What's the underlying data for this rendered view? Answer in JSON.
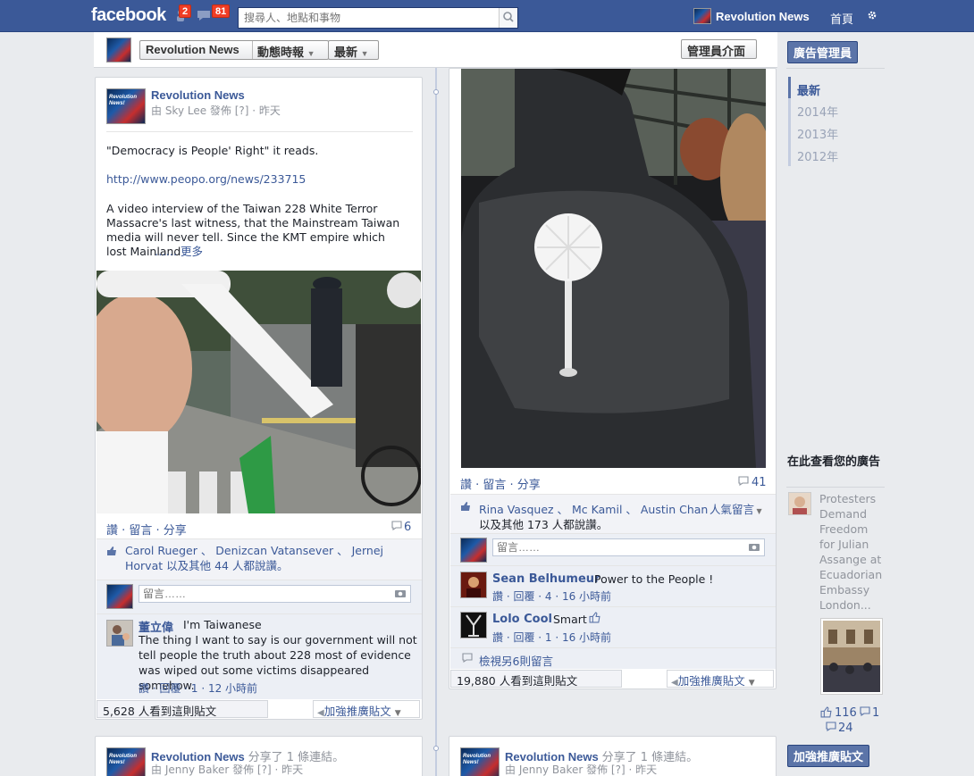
{
  "topbar": {
    "logo": "facebook",
    "friend_badge": "2",
    "notif_badge": "81",
    "search_placeholder": "搜尋人、地點和事物",
    "page_name": "Revolution News",
    "home": "首頁"
  },
  "header": {
    "page_name": "Revolution News",
    "timeline": "動態時報",
    "recent": "最新",
    "admin_panel": "管理員介面"
  },
  "sidebar": {
    "ad_manager": "廣告管理員",
    "years": [
      "最新",
      "2014年",
      "2013年",
      "2012年"
    ],
    "ads_title": "在此查看您的廣告",
    "ad_text": "Protesters Demand Freedom for Julian Assange at Ecuadorian Embassy London...",
    "likes": "116",
    "comments": "1",
    "shares": "24",
    "promote": "加強推廣貼文"
  },
  "post1": {
    "page_name": "Revolution News",
    "byline": "由 Sky Lee 發佈 [?] · 昨天",
    "quote": "\"Democracy is People' Right\" it reads.",
    "link": "http://www.peopo.org/news/233715",
    "text": "A video interview of the Taiwan 228 White Terror Massacre's last witness, that the Mainstream Taiwan media will never tell. Since the KMT empire which lost Mainland",
    "more": "…… 更多",
    "actions": "讚 · 留言 · 分享",
    "comment_count": "6",
    "likers": "Carol Rueger 、 Denizcan Vatansever 、 Jernej Horvat 以及其他 44 人都說讚。",
    "comment_placeholder": "留言……",
    "comment_author": "董立偉",
    "comment_lead": "I'm Taiwanese",
    "comment_body": "The thing I want to say is our government will not tell people the truth about 228 most of evidence was wiped out some victims disappeared somehow.",
    "comment_meta": "讚 · 回覆 · 1 · 12 小時前",
    "seen": "5,628 人看到這則貼文",
    "promote": "加強推廣貼文"
  },
  "post2": {
    "actions": "讚 · 留言 · 分享",
    "comment_count": "41",
    "likers_names": "Rina Vasquez 、 Mc Kamil 、 Austin Chan",
    "likers_rest": "以及其他 173 人都說讚。",
    "popular": "人氣留言",
    "comment_placeholder": "留言……",
    "c1_author": "Sean Belhumeur",
    "c1_text": "Power to the People !",
    "c1_meta": "讚 · 回覆 · 4 · 16 小時前",
    "c2_author": "Lolo Cool",
    "c2_text": "Smart",
    "c2_meta": "讚 · 回覆 · 1 · 16 小時前",
    "view_more": "檢視另6則留言",
    "seen": "19,880 人看到這則貼文",
    "promote": "加強推廣貼文"
  },
  "post3": {
    "page_name": "Revolution News",
    "shared": "分享了 1 條連結。",
    "byline": "由 Jenny Baker 發佈 [?] · 昨天"
  },
  "post4": {
    "page_name": "Revolution News",
    "shared": "分享了 1 條連結。",
    "byline": "由 Jenny Baker 發佈 [?] · 昨天"
  },
  "avatar_text": "Revolution News!"
}
